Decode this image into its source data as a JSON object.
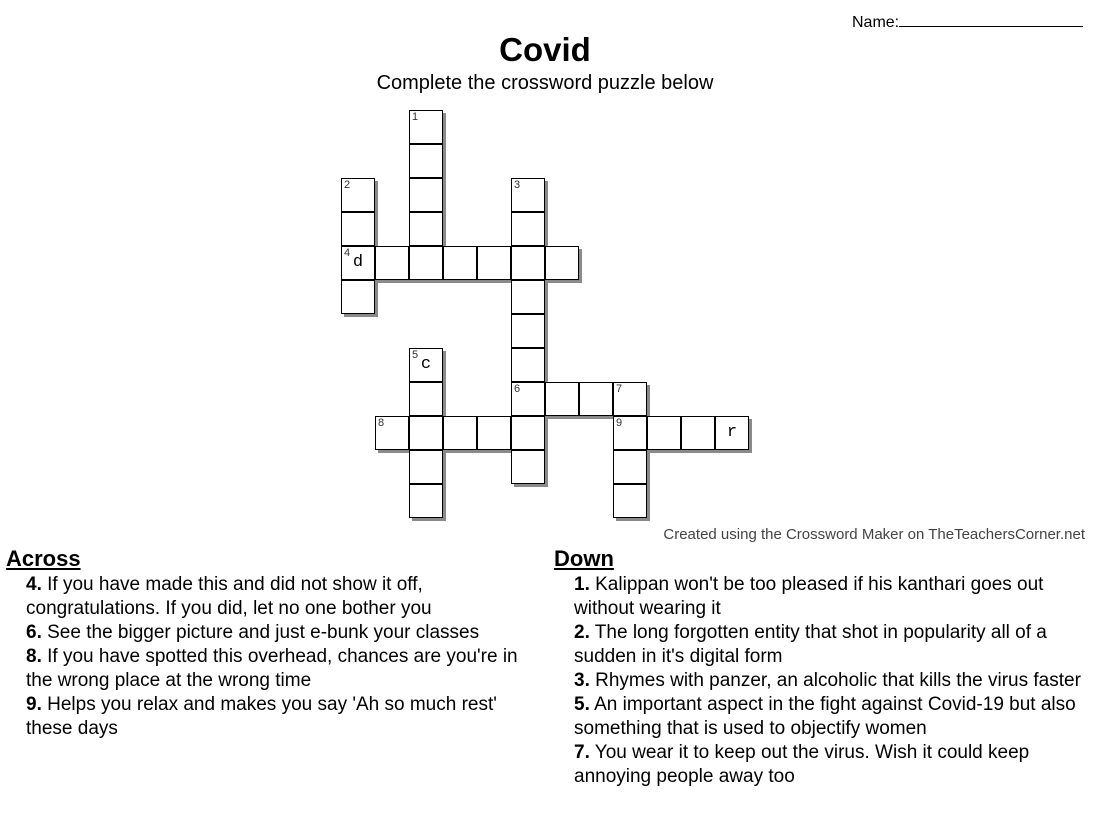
{
  "header": {
    "name_label": "Name:",
    "title": "Covid",
    "subtitle": "Complete the crossword puzzle below"
  },
  "grid": {
    "cells": [
      {
        "col": 2,
        "row": 0,
        "num": "1",
        "letter": ""
      },
      {
        "col": 2,
        "row": 1,
        "num": "",
        "letter": ""
      },
      {
        "col": 0,
        "row": 2,
        "num": "2",
        "letter": ""
      },
      {
        "col": 2,
        "row": 2,
        "num": "",
        "letter": ""
      },
      {
        "col": 5,
        "row": 2,
        "num": "3",
        "letter": ""
      },
      {
        "col": 0,
        "row": 3,
        "num": "",
        "letter": ""
      },
      {
        "col": 2,
        "row": 3,
        "num": "",
        "letter": ""
      },
      {
        "col": 5,
        "row": 3,
        "num": "",
        "letter": ""
      },
      {
        "col": 0,
        "row": 4,
        "num": "4",
        "letter": "d"
      },
      {
        "col": 1,
        "row": 4,
        "num": "",
        "letter": ""
      },
      {
        "col": 2,
        "row": 4,
        "num": "",
        "letter": ""
      },
      {
        "col": 3,
        "row": 4,
        "num": "",
        "letter": ""
      },
      {
        "col": 4,
        "row": 4,
        "num": "",
        "letter": ""
      },
      {
        "col": 5,
        "row": 4,
        "num": "",
        "letter": ""
      },
      {
        "col": 6,
        "row": 4,
        "num": "",
        "letter": ""
      },
      {
        "col": 0,
        "row": 5,
        "num": "",
        "letter": ""
      },
      {
        "col": 5,
        "row": 5,
        "num": "",
        "letter": ""
      },
      {
        "col": 5,
        "row": 6,
        "num": "",
        "letter": ""
      },
      {
        "col": 2,
        "row": 7,
        "num": "5",
        "letter": "c"
      },
      {
        "col": 5,
        "row": 7,
        "num": "",
        "letter": ""
      },
      {
        "col": 2,
        "row": 8,
        "num": "",
        "letter": ""
      },
      {
        "col": 5,
        "row": 8,
        "num": "6",
        "letter": ""
      },
      {
        "col": 6,
        "row": 8,
        "num": "",
        "letter": ""
      },
      {
        "col": 7,
        "row": 8,
        "num": "",
        "letter": ""
      },
      {
        "col": 8,
        "row": 8,
        "num": "7",
        "letter": ""
      },
      {
        "col": 1,
        "row": 9,
        "num": "8",
        "letter": ""
      },
      {
        "col": 2,
        "row": 9,
        "num": "",
        "letter": ""
      },
      {
        "col": 3,
        "row": 9,
        "num": "",
        "letter": ""
      },
      {
        "col": 4,
        "row": 9,
        "num": "",
        "letter": ""
      },
      {
        "col": 5,
        "row": 9,
        "num": "",
        "letter": ""
      },
      {
        "col": 8,
        "row": 9,
        "num": "9",
        "letter": ""
      },
      {
        "col": 9,
        "row": 9,
        "num": "",
        "letter": ""
      },
      {
        "col": 10,
        "row": 9,
        "num": "",
        "letter": ""
      },
      {
        "col": 11,
        "row": 9,
        "num": "",
        "letter": "r"
      },
      {
        "col": 2,
        "row": 10,
        "num": "",
        "letter": ""
      },
      {
        "col": 5,
        "row": 10,
        "num": "",
        "letter": ""
      },
      {
        "col": 8,
        "row": 10,
        "num": "",
        "letter": ""
      },
      {
        "col": 2,
        "row": 11,
        "num": "",
        "letter": ""
      },
      {
        "col": 8,
        "row": 11,
        "num": "",
        "letter": ""
      }
    ]
  },
  "credit": "Created using the Crossword Maker on TheTeachersCorner.net",
  "across": {
    "heading": "Across",
    "clues": [
      {
        "num": "4.",
        "text": "If you have made this and did not show it off, congratulations. If you did, let no one bother you"
      },
      {
        "num": "6.",
        "text": "See the bigger picture and just e-bunk your classes"
      },
      {
        "num": "8.",
        "text": "If you have spotted this overhead, chances are you're in the wrong place at the wrong time"
      },
      {
        "num": "9.",
        "text": "Helps you relax and makes you say 'Ah so much rest' these days"
      }
    ]
  },
  "down": {
    "heading": "Down",
    "clues": [
      {
        "num": "1.",
        "text": "Kalippan won't be too pleased if his kanthari goes out without wearing it"
      },
      {
        "num": "2.",
        "text": "The long forgotten entity that shot in popularity all of a sudden in it's digital form"
      },
      {
        "num": "3.",
        "text": "Rhymes with panzer, an alcoholic that kills the virus faster"
      },
      {
        "num": "5.",
        "text": "An important aspect in the fight against Covid-19 but also something that is used to objectify women"
      },
      {
        "num": "7.",
        "text": "You wear it to keep out the virus. Wish it could keep annoying people away too"
      }
    ]
  }
}
